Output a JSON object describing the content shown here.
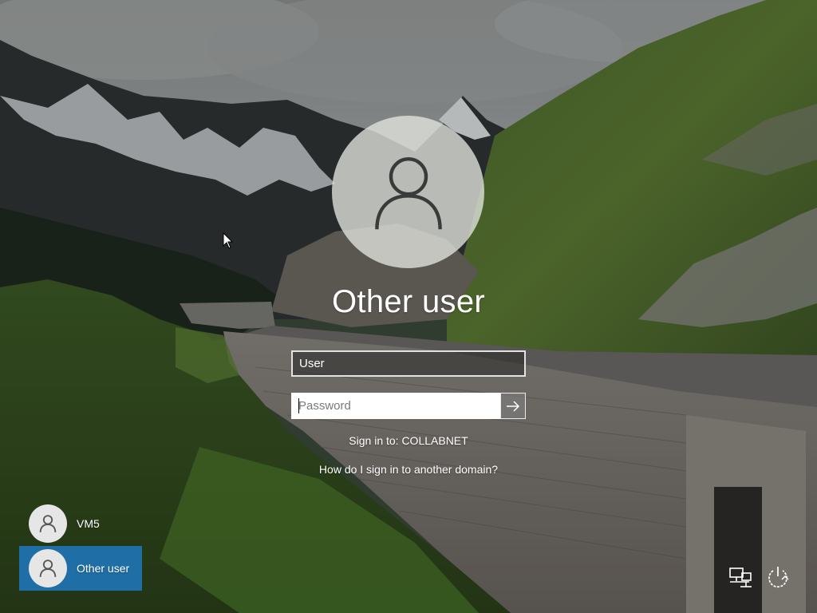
{
  "selected_user": {
    "name": "Other user",
    "avatar_icon": "user-icon"
  },
  "signin_form": {
    "username_value": "User",
    "password_placeholder": "Password",
    "submit_icon": "arrow-right-icon"
  },
  "signin_domain_text": "Sign in to: COLLABNET",
  "other_domain_link": "How do I sign in to another domain?",
  "user_list": [
    {
      "name": "VM5",
      "avatar_icon": "user-icon",
      "selected": false
    },
    {
      "name": "Other user",
      "avatar_icon": "user-icon",
      "selected": true
    }
  ],
  "system_icons": {
    "network": "network-icon",
    "power": "power-icon"
  },
  "colors": {
    "selection_accent": "#1f6fa6",
    "text": "#ffffff"
  }
}
